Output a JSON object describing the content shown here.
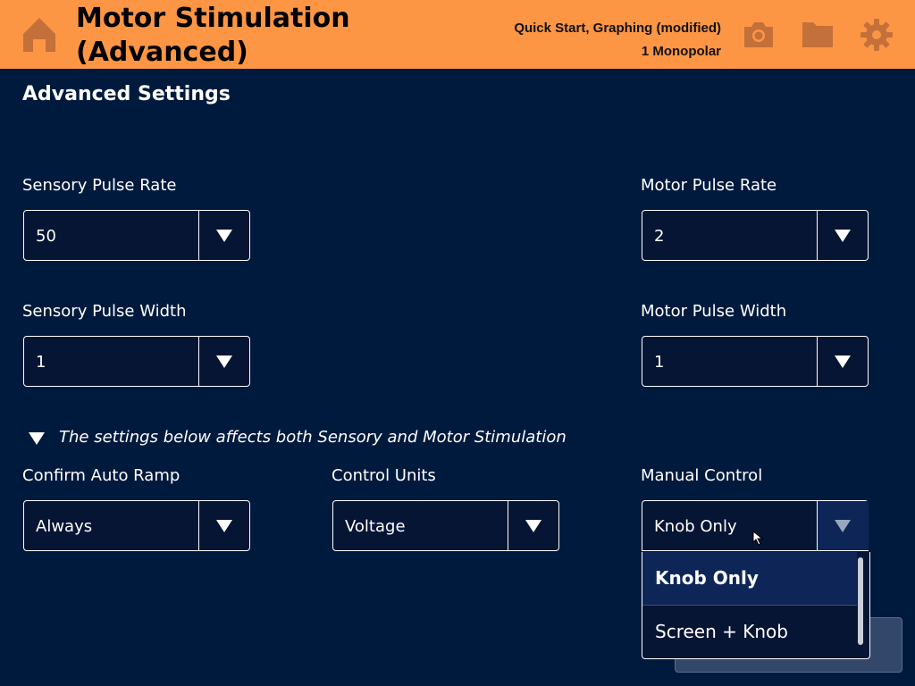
{
  "header": {
    "title_line1": "Motor Stimulation",
    "title_line2": "(Advanced)",
    "protocol": "Quick Start, Graphing (modified)",
    "electrode": "1 Monopolar",
    "icons": [
      "home-icon",
      "camera-icon",
      "folder-icon",
      "gear-icon"
    ],
    "accent": "#fd9644"
  },
  "section_title": "Advanced Settings",
  "fields": {
    "sensory_pulse_rate": {
      "label": "Sensory Pulse Rate",
      "value": "50"
    },
    "motor_pulse_rate": {
      "label": "Motor Pulse Rate",
      "value": "2"
    },
    "sensory_pulse_width": {
      "label": "Sensory Pulse Width",
      "value": "1"
    },
    "motor_pulse_width": {
      "label": "Motor Pulse Width",
      "value": "1"
    },
    "confirm_auto_ramp": {
      "label": "Confirm Auto Ramp",
      "value": "Always"
    },
    "control_units": {
      "label": "Control Units",
      "value": "Voltage"
    },
    "manual_control": {
      "label": "Manual Control",
      "value": "Knob Only"
    }
  },
  "note": "The settings below affects both Sensory and Motor Stimulation",
  "manual_control_options": [
    "Knob Only",
    "Screen + Knob"
  ],
  "colors": {
    "background": "#001a3d",
    "header": "#fd9644",
    "field_bg": "#061533",
    "selected_option": "#0d2657"
  }
}
